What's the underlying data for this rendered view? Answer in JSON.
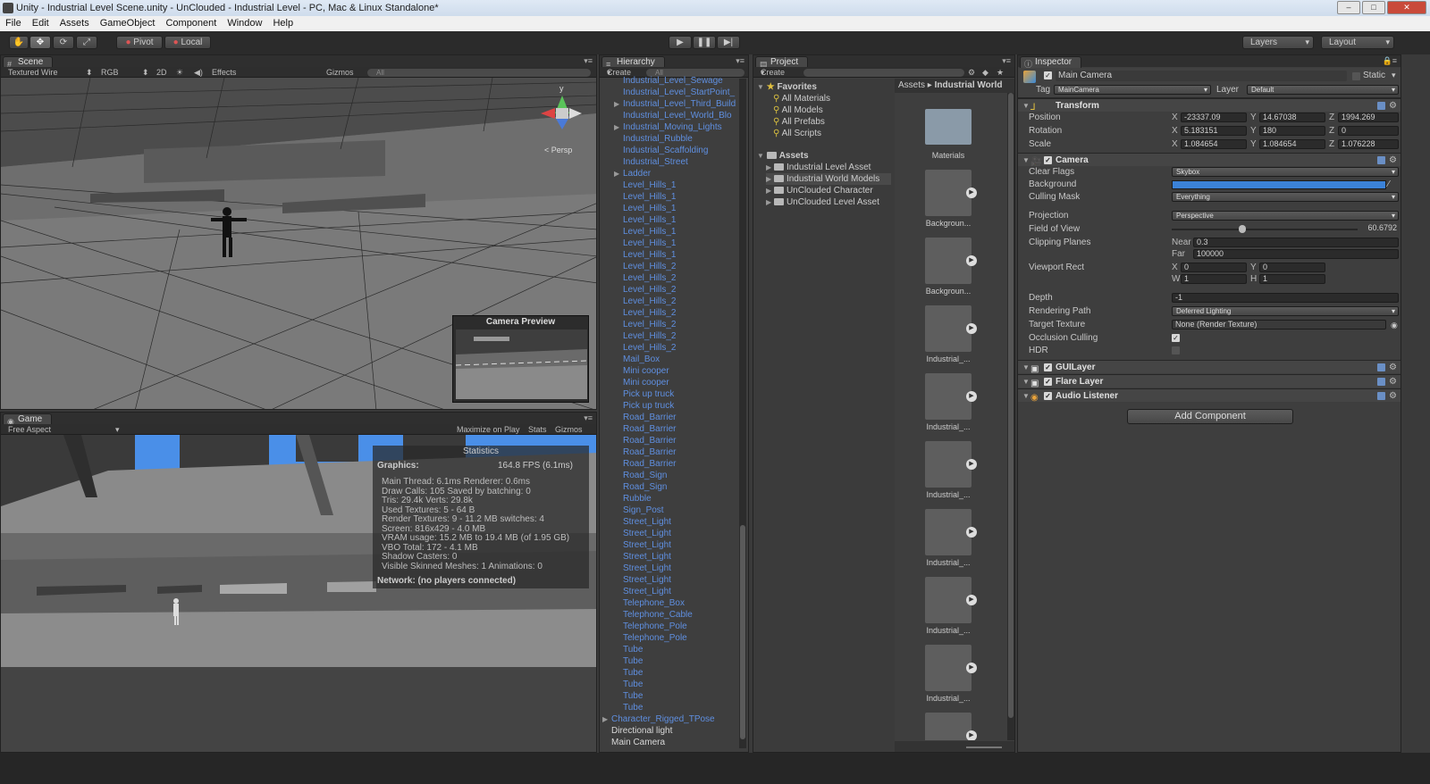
{
  "window": {
    "title": "Unity - Industrial Level Scene.unity - UnClouded - Industrial Level - PC, Mac & Linux Standalone*",
    "minimize": "–",
    "maximize": "□",
    "close": "✕"
  },
  "menu": [
    "File",
    "Edit",
    "Assets",
    "GameObject",
    "Component",
    "Window",
    "Help"
  ],
  "toolbar": {
    "pivot": "Pivot",
    "local": "Local",
    "layers": "Layers",
    "layout": "Layout"
  },
  "scene": {
    "tab": "Scene",
    "draw_mode": "Textured Wire",
    "render_mode": "RGB",
    "mode_2d": "2D",
    "effects": "Effects",
    "gizmos": "Gizmos",
    "search_placeholder": "All",
    "persp": "Persp",
    "gizmo_y": "y",
    "camera_preview": "Camera Preview"
  },
  "game": {
    "tab": "Game",
    "aspect": "Free Aspect",
    "maximize": "Maximize on Play",
    "stats": "Stats",
    "gizmos": "Gizmos",
    "statistics": {
      "title": "Statistics",
      "graphics_label": "Graphics:",
      "fps": "164.8 FPS (6.1ms)",
      "lines": [
        "Main Thread: 6.1ms   Renderer: 0.6ms",
        "Draw Calls: 105   Saved by batching: 0",
        "Tris: 29.4k   Verts: 29.8k",
        "Used Textures: 5 - 64 B",
        "Render Textures: 9 - 11.2 MB    switches: 4",
        "Screen: 816x429 - 4.0 MB",
        "VRAM usage: 15.2 MB to 19.4 MB (of 1.95 GB)",
        "VBO Total: 172 - 4.1 MB",
        "Shadow Casters: 0",
        "Visible Skinned Meshes: 1      Animations: 0"
      ],
      "network": "Network: (no players connected)"
    }
  },
  "hierarchy": {
    "tab": "Hierarchy",
    "create": "Create",
    "search_placeholder": "All",
    "items": [
      {
        "label": "Industrial_Level_Sewage",
        "arrow": ""
      },
      {
        "label": "Industrial_Level_StartPoint_",
        "arrow": ""
      },
      {
        "label": "Industrial_Level_Third_Build",
        "arrow": "▶"
      },
      {
        "label": "Industrial_Level_World_Blo",
        "arrow": ""
      },
      {
        "label": "Industrial_Moving_Lights",
        "arrow": "▶"
      },
      {
        "label": "Industrial_Rubble",
        "arrow": ""
      },
      {
        "label": "Industrial_Scaffolding",
        "arrow": ""
      },
      {
        "label": "Industrial_Street",
        "arrow": ""
      },
      {
        "label": "Ladder",
        "arrow": "▶"
      },
      {
        "label": "Level_Hills_1",
        "arrow": ""
      },
      {
        "label": "Level_Hills_1",
        "arrow": ""
      },
      {
        "label": "Level_Hills_1",
        "arrow": ""
      },
      {
        "label": "Level_Hills_1",
        "arrow": ""
      },
      {
        "label": "Level_Hills_1",
        "arrow": ""
      },
      {
        "label": "Level_Hills_1",
        "arrow": ""
      },
      {
        "label": "Level_Hills_1",
        "arrow": ""
      },
      {
        "label": "Level_Hills_2",
        "arrow": ""
      },
      {
        "label": "Level_Hills_2",
        "arrow": ""
      },
      {
        "label": "Level_Hills_2",
        "arrow": ""
      },
      {
        "label": "Level_Hills_2",
        "arrow": ""
      },
      {
        "label": "Level_Hills_2",
        "arrow": ""
      },
      {
        "label": "Level_Hills_2",
        "arrow": ""
      },
      {
        "label": "Level_Hills_2",
        "arrow": ""
      },
      {
        "label": "Level_Hills_2",
        "arrow": ""
      },
      {
        "label": "Mail_Box",
        "arrow": ""
      },
      {
        "label": "Mini cooper",
        "arrow": ""
      },
      {
        "label": "Mini cooper",
        "arrow": ""
      },
      {
        "label": "Pick up truck",
        "arrow": ""
      },
      {
        "label": "Pick up truck",
        "arrow": ""
      },
      {
        "label": "Road_Barrier",
        "arrow": ""
      },
      {
        "label": "Road_Barrier",
        "arrow": ""
      },
      {
        "label": "Road_Barrier",
        "arrow": ""
      },
      {
        "label": "Road_Barrier",
        "arrow": ""
      },
      {
        "label": "Road_Barrier",
        "arrow": ""
      },
      {
        "label": "Road_Sign",
        "arrow": ""
      },
      {
        "label": "Road_Sign",
        "arrow": ""
      },
      {
        "label": "Rubble",
        "arrow": ""
      },
      {
        "label": "Sign_Post",
        "arrow": ""
      },
      {
        "label": "Street_Light",
        "arrow": ""
      },
      {
        "label": "Street_Light",
        "arrow": ""
      },
      {
        "label": "Street_Light",
        "arrow": ""
      },
      {
        "label": "Street_Light",
        "arrow": ""
      },
      {
        "label": "Street_Light",
        "arrow": ""
      },
      {
        "label": "Street_Light",
        "arrow": ""
      },
      {
        "label": "Street_Light",
        "arrow": ""
      },
      {
        "label": "Telephone_Box",
        "arrow": ""
      },
      {
        "label": "Telephone_Cable",
        "arrow": ""
      },
      {
        "label": "Telephone_Pole",
        "arrow": ""
      },
      {
        "label": "Telephone_Pole",
        "arrow": ""
      },
      {
        "label": "Tube",
        "arrow": ""
      },
      {
        "label": "Tube",
        "arrow": ""
      },
      {
        "label": "Tube",
        "arrow": ""
      },
      {
        "label": "Tube",
        "arrow": ""
      },
      {
        "label": "Tube",
        "arrow": ""
      },
      {
        "label": "Tube",
        "arrow": ""
      }
    ],
    "root_items": [
      {
        "label": "Character_Rigged_TPose",
        "arrow": "▶",
        "white": false
      },
      {
        "label": "Directional light",
        "arrow": "",
        "white": true
      },
      {
        "label": "Main Camera",
        "arrow": "",
        "white": true
      }
    ]
  },
  "project": {
    "tab": "Project",
    "create": "Create",
    "favorites_label": "Favorites",
    "favorites": [
      "All Materials",
      "All Models",
      "All Prefabs",
      "All Scripts"
    ],
    "assets_label": "Assets",
    "folders": [
      "Industrial Level Asset",
      "Industrial World Models",
      "UnClouded Character",
      "UnClouded Level Asset"
    ],
    "breadcrumb_root": "Assets",
    "breadcrumb_sep": "▸",
    "breadcrumb_current": "Industrial World",
    "grid": [
      "Materials",
      "Backgroun...",
      "Backgroun...",
      "Industrial_...",
      "Industrial_...",
      "Industrial_...",
      "Industrial_...",
      "Industrial_...",
      "Industrial_...",
      ""
    ]
  },
  "inspector": {
    "tab": "Inspector",
    "object_name": "Main Camera",
    "static_label": "Static",
    "tag_label": "Tag",
    "tag_value": "MainCamera",
    "layer_label": "Layer",
    "layer_value": "Default",
    "transform": {
      "title": "Transform",
      "position": {
        "label": "Position",
        "x": "-23337.09",
        "y": "14.67038",
        "z": "1994.269"
      },
      "rotation": {
        "label": "Rotation",
        "x": "5.183151",
        "y": "180",
        "z": "0"
      },
      "scale": {
        "label": "Scale",
        "x": "1.084654",
        "y": "1.084654",
        "z": "1.076228"
      }
    },
    "camera": {
      "title": "Camera",
      "clear_flags": {
        "label": "Clear Flags",
        "value": "Skybox"
      },
      "background": {
        "label": "Background",
        "color": "#3b82d8"
      },
      "culling_mask": {
        "label": "Culling Mask",
        "value": "Everything"
      },
      "projection": {
        "label": "Projection",
        "value": "Perspective"
      },
      "fov": {
        "label": "Field of View",
        "value": "60.6792",
        "fraction": 0.36
      },
      "clipping": {
        "label": "Clipping Planes",
        "near_label": "Near",
        "near": "0.3",
        "far_label": "Far",
        "far": "100000"
      },
      "viewport": {
        "label": "Viewport Rect",
        "x": "0",
        "y": "0",
        "w": "1",
        "h": "1"
      },
      "depth": {
        "label": "Depth",
        "value": "-1"
      },
      "rendering_path": {
        "label": "Rendering Path",
        "value": "Deferred Lighting"
      },
      "target_texture": {
        "label": "Target Texture",
        "value": "None (Render Texture)"
      },
      "occlusion": {
        "label": "Occlusion Culling",
        "checked": "✓"
      },
      "hdr": {
        "label": "HDR"
      }
    },
    "components": [
      "GUILayer",
      "Flare Layer",
      "Audio Listener"
    ],
    "add_component": "Add Component"
  },
  "axis_letters": {
    "x": "X",
    "y": "Y",
    "z": "Z",
    "w": "W",
    "h": "H"
  }
}
